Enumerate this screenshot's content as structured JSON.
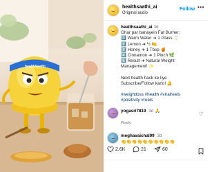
{
  "post": {
    "author": "healthsaathi_ai",
    "audio": "Original audio",
    "follow_label": "Follow",
    "more_label": "•••"
  },
  "caption": {
    "username": "healthsaathi_ai",
    "time": "3d",
    "lines": [
      "Ghar par banayein Fat Burner:",
      "1️⃣  Warm Water ➜ 1 Glass 🥛",
      "2️⃣  Lemon ➜ ½ 🍋",
      "3️⃣  Honey ➜ 1 Tbsp 🍯",
      "4️⃣  Cinnamon ➜ 1 Pinch 🌿",
      "5️⃣  Result ➜ Natural Weight",
      "Management! ✨",
      "Next health hack ke liye",
      "Subscribe/Follow karlo! 🔔",
      "#weightloss #health #viralreels",
      "#positivity #reels"
    ]
  },
  "comments": [
    {
      "username": "yogasri7819",
      "time": "3d",
      "text": "🙏",
      "reply_label": "Reply"
    },
    {
      "username": "meghavaichal99",
      "time": "3d",
      "text": "👏👏👏👏👏👏👏👏👏👏"
    }
  ],
  "actions": {
    "likes": "2.6K",
    "comments": "21",
    "shares": "60"
  },
  "colors": {
    "accent": "#0095f6",
    "hashtag": "#00376b"
  }
}
